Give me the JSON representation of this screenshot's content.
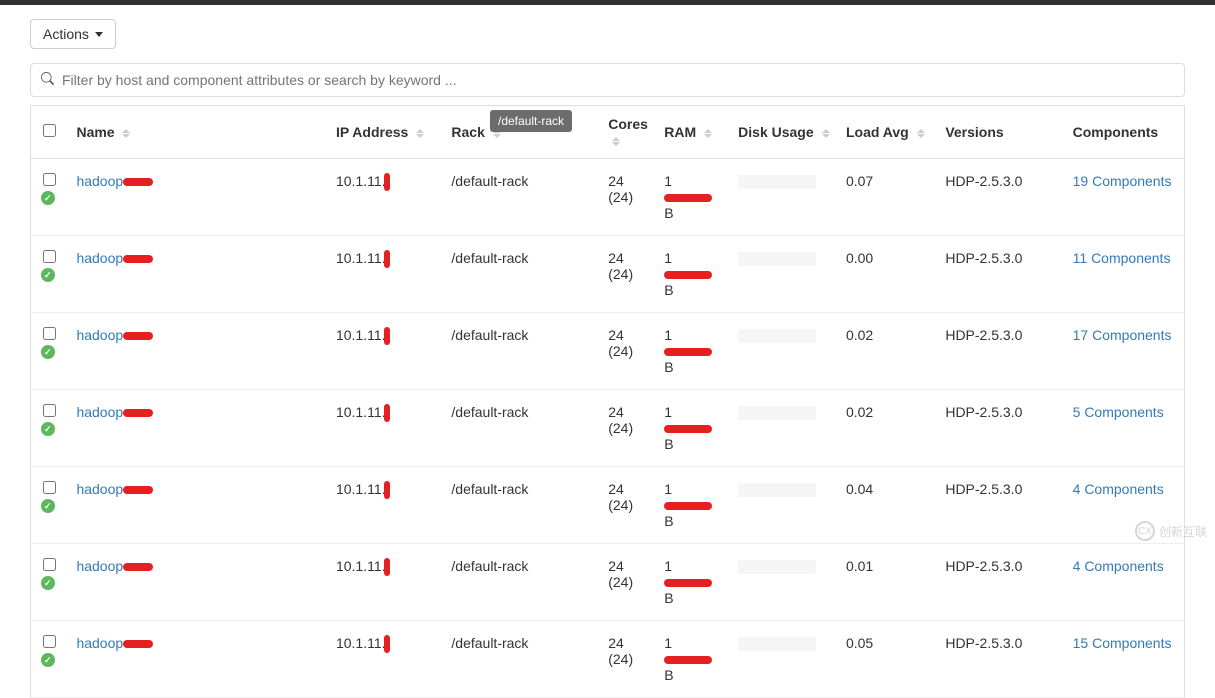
{
  "actions": {
    "label": "Actions"
  },
  "filter": {
    "placeholder": "Filter by host and component attributes or search by keyword ..."
  },
  "tooltip": {
    "text": "/default-rack"
  },
  "columns": {
    "name": "Name",
    "ip": "IP Address",
    "rack": "Rack",
    "cores": "Cores",
    "ram": "RAM",
    "disk": "Disk Usage",
    "load": "Load Avg",
    "versions": "Versions",
    "components": "Components"
  },
  "hosts": [
    {
      "name_prefix": "hadoop",
      "ip": "10.1.11.",
      "rack": "/default-rack",
      "cores": "24",
      "cores_sub": "(24)",
      "ram_suffix": "B",
      "load": "0.07",
      "version": "HDP-2.5.3.0",
      "components": "19 Components"
    },
    {
      "name_prefix": "hadoop",
      "ip": "10.1.11.",
      "rack": "/default-rack",
      "cores": "24",
      "cores_sub": "(24)",
      "ram_suffix": "B",
      "load": "0.00",
      "version": "HDP-2.5.3.0",
      "components": "11 Components"
    },
    {
      "name_prefix": "hadoop",
      "ip": "10.1.11.",
      "rack": "/default-rack",
      "cores": "24",
      "cores_sub": "(24)",
      "ram_suffix": "B",
      "load": "0.02",
      "version": "HDP-2.5.3.0",
      "components": "17 Components"
    },
    {
      "name_prefix": "hadoop",
      "ip": "10.1.11.",
      "rack": "/default-rack",
      "cores": "24",
      "cores_sub": "(24)",
      "ram_suffix": "B",
      "load": "0.02",
      "version": "HDP-2.5.3.0",
      "components": "5 Components"
    },
    {
      "name_prefix": "hadoop",
      "ip": "10.1.11.",
      "rack": "/default-rack",
      "cores": "24",
      "cores_sub": "(24)",
      "ram_suffix": "B",
      "load": "0.04",
      "version": "HDP-2.5.3.0",
      "components": "4 Components"
    },
    {
      "name_prefix": "hadoop",
      "ip": "10.1.11.",
      "rack": "/default-rack",
      "cores": "24",
      "cores_sub": "(24)",
      "ram_suffix": "B",
      "load": "0.01",
      "version": "HDP-2.5.3.0",
      "components": "4 Components"
    },
    {
      "name_prefix": "hadoop",
      "ip": "10.1.11.",
      "rack": "/default-rack",
      "cores": "24",
      "cores_sub": "(24)",
      "ram_suffix": "B",
      "load": "0.05",
      "version": "HDP-2.5.3.0",
      "components": "15 Components"
    }
  ],
  "watermark": {
    "text": "创新互联"
  }
}
